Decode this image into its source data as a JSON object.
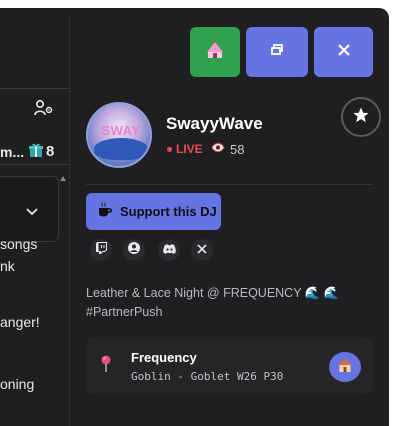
{
  "window": {
    "buttons": [
      {
        "name": "circus-tent-button",
        "icon": "circus-tent-icon",
        "color": "#2fa24e"
      },
      {
        "name": "restore-window-button",
        "icon": "restore-window-icon",
        "color": "#6673e3"
      },
      {
        "name": "close-window-button",
        "icon": "close-icon",
        "color": "#6673e3"
      }
    ]
  },
  "left_panel": {
    "users_icon": "users-settings-icon",
    "truncated_title": "m...",
    "gift_icon": "gift-icon",
    "gift_count": "8",
    "lines": [
      "songs",
      "nk",
      "anger!",
      "oning"
    ]
  },
  "dj": {
    "name": "SwayyWave",
    "avatar_logo_text": "SWAY",
    "live_label": "LIVE",
    "viewer_icon": "eye-icon",
    "viewers": "58",
    "favorite_icon": "star-icon"
  },
  "support": {
    "icon": "coffee-cup-icon",
    "label": "Support this DJ"
  },
  "socials": [
    {
      "name": "twitch-link",
      "icon": "twitch-icon"
    },
    {
      "name": "profile-link",
      "icon": "user-circle-icon"
    },
    {
      "name": "discord-link",
      "icon": "discord-icon"
    },
    {
      "name": "x-link",
      "icon": "x-icon"
    }
  ],
  "description": {
    "text": "Leather & Lace Night @ FREQUENCY 🌊 🌊 #PartnerPush"
  },
  "venue": {
    "pin_icon": "map-pin-icon",
    "name": "Frequency",
    "location": "Goblin - Goblet W26 P30",
    "button_icon": "house-icon"
  },
  "colors": {
    "background": "#1f1f21",
    "accent": "#6673e3",
    "green": "#2fa24e",
    "live": "#ec4b4b"
  }
}
